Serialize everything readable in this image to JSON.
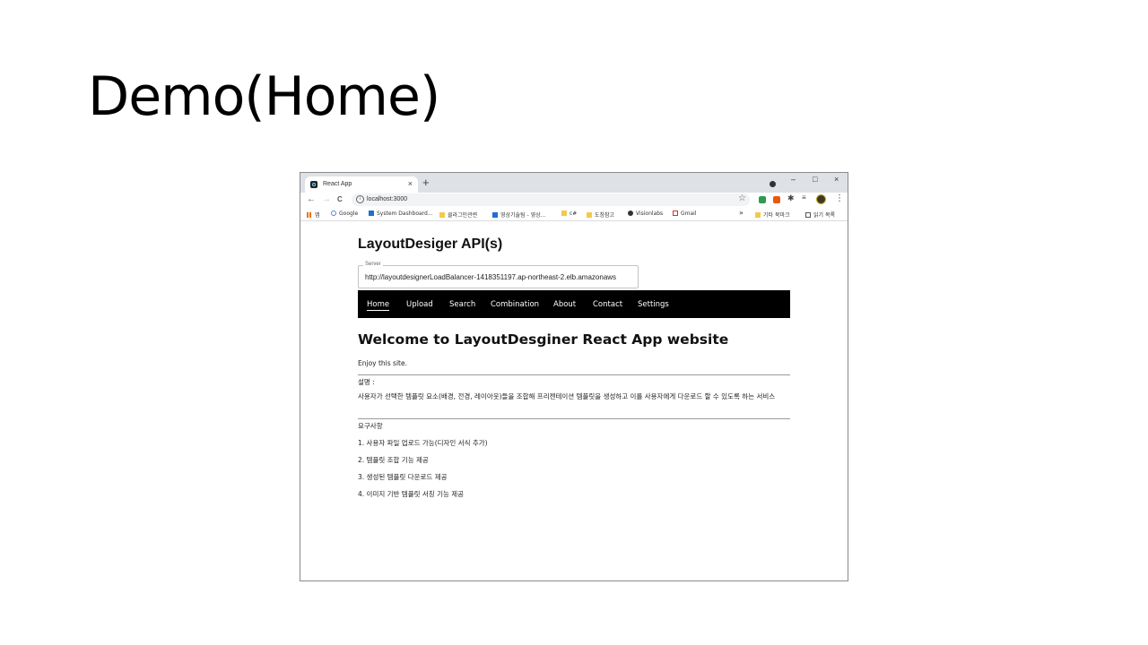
{
  "slide": {
    "title": "Demo(Home)"
  },
  "browser": {
    "tab_title": "React App",
    "new_tab": "+",
    "tab_close": "×",
    "window_controls": {
      "minimize": "–",
      "maximize": "□",
      "close": "×"
    },
    "url": "localhost:3000",
    "nav": {
      "back": "←",
      "forward": "→",
      "reload": "C"
    },
    "bookmarks": [
      {
        "label": "앱",
        "icon": "apps-grid-icon"
      },
      {
        "label": "Google",
        "icon": "google-icon"
      },
      {
        "label": "System Dashboard...",
        "icon": "h-logo-icon"
      },
      {
        "label": "클라그인관련",
        "icon": "folder-icon"
      },
      {
        "label": "영상기술팀 - 영상...",
        "icon": "h-logo-icon"
      },
      {
        "label": "c#",
        "icon": "folder-icon"
      },
      {
        "label": "도창참고",
        "icon": "folder-icon"
      },
      {
        "label": "Visionlabs",
        "icon": "globe-icon"
      },
      {
        "label": "Gmail",
        "icon": "gmail-icon"
      }
    ],
    "bookmarks_overflow": "»",
    "other_bookmarks": "기타 북마크",
    "reading_list": "읽기 목록"
  },
  "app": {
    "heading": "LayoutDesiger API(s)",
    "server_label": "Server",
    "server_value": "http://layoutdesignerLoadBalancer-1418351197.ap-northeast-2.elb.amazonaws",
    "nav": [
      "Home",
      "Upload",
      "Search",
      "Combination",
      "About",
      "Contact",
      "Settings"
    ],
    "active_nav": "Home",
    "welcome": "Welcome to LayoutDesginer React App website",
    "enjoy": "Enjoy this site.",
    "desc_label": "설명 :",
    "desc_text": "사용자가 선택한 템플릿 요소(배경, 전경, 레이아웃)들을 조합해 프리젠테이션 템플릿을 생성하고 이를 사용자에게 다운로드 할 수 있도록 하는 서비스",
    "req_label": "요구사항",
    "requirements": [
      "1. 사용자 파일 업로드 가능(디자인 서식 추가)",
      "2. 템플릿 조합 기능 제공",
      "3. 생성된 템플릿 다운로드 제공",
      "4. 이미지 기반 템플릿 서칭 기능 제공"
    ]
  }
}
